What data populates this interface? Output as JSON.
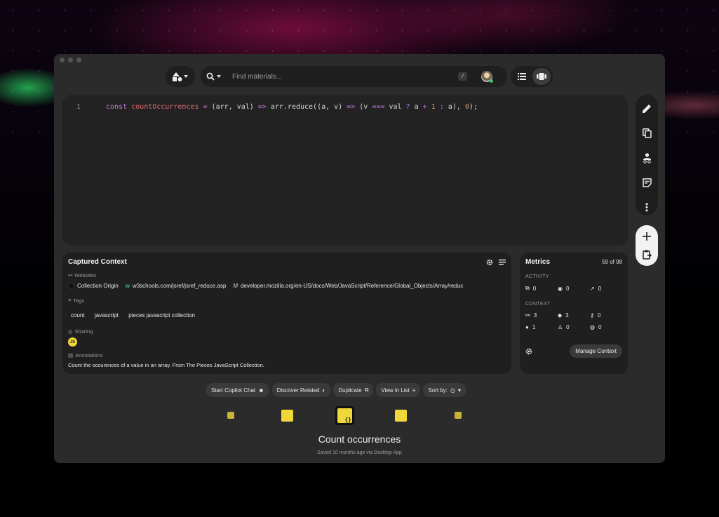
{
  "toolbar": {
    "search_placeholder": "Find materials...",
    "shortcut": "/"
  },
  "editor": {
    "line_number": "1",
    "code": "const countOccurrences = (arr, val) => arr.reduce((a, v) => (v === val ? a + 1 : a), 0);"
  },
  "context": {
    "title": "Captured Context",
    "websites_label": "Websites",
    "websites": [
      "Collection Origin",
      "w3schools.com/jsref/jsref_reduce.asp",
      "developer.mozilla.org/en-US/docs/Web/JavaScript/Reference/Global_Objects/Array/reduc"
    ],
    "tags_label": "Tags",
    "tags": [
      "count",
      "javascript",
      "pieces javascript collection"
    ],
    "sharing_label": "Sharing",
    "sharing_avatar": "JS",
    "annotations_label": "Annotations",
    "annotation": "Count the occurences of a value in an array. From The Pieces JavaScript Collection."
  },
  "metrics": {
    "title": "Metrics",
    "count": "59 of 98",
    "activity_label": "ACTIVITY",
    "activity": [
      "0",
      "0",
      "0"
    ],
    "context_label": "CONTEXT",
    "context_row1": [
      "3",
      "3",
      "0"
    ],
    "context_row2": [
      "1",
      "0",
      "0"
    ],
    "manage_button": "Manage Context"
  },
  "actions": {
    "copilot": "Start Copilot Chat",
    "discover": "Discover Related",
    "duplicate": "Duplicate",
    "view_list": "View in List",
    "sort": "Sort by:"
  },
  "material": {
    "title": "Count occurrences",
    "saved": "Saved 10 months ago via Desktop App"
  },
  "colors": {
    "accent_yellow": "#f0d83a",
    "panel": "#1f1f1f",
    "window": "#2b2b2b"
  }
}
